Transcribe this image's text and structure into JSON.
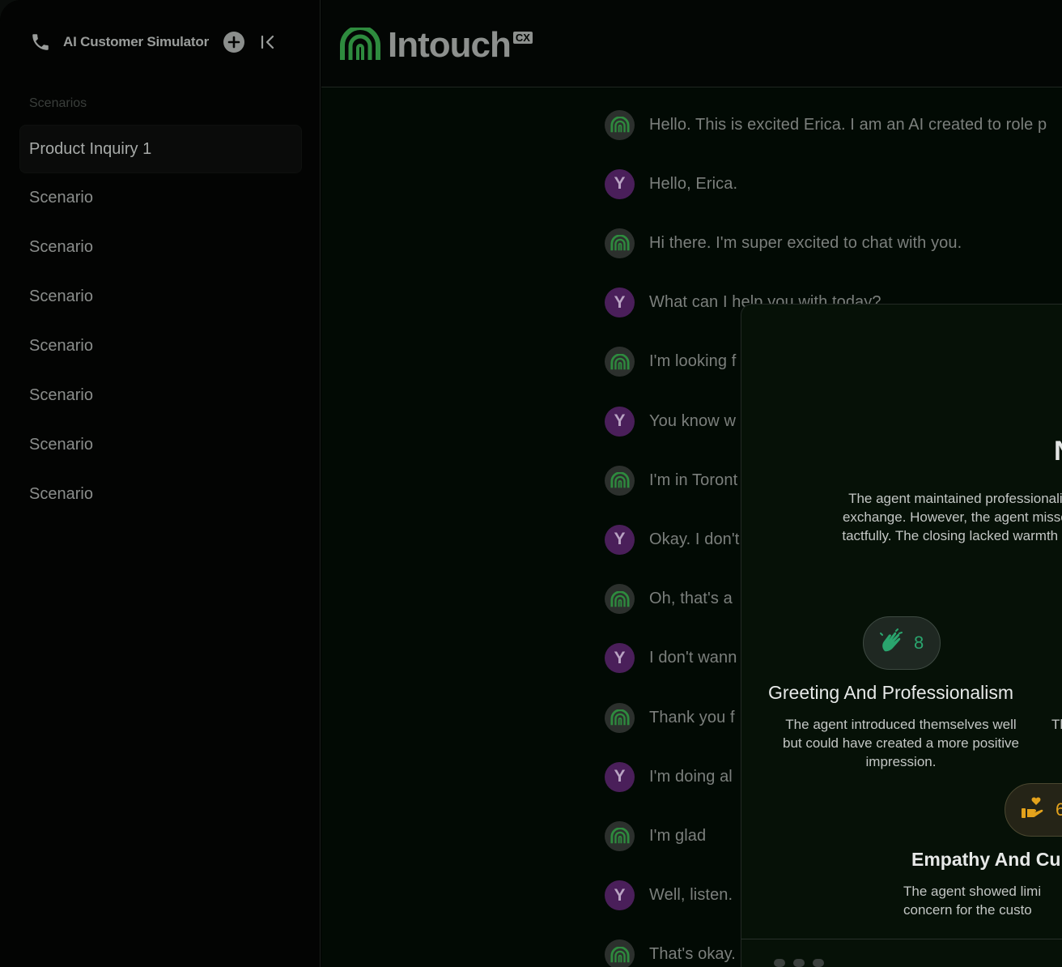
{
  "sidebar": {
    "title": "AI Customer Simulator",
    "section_label": "Scenarios",
    "items": [
      {
        "label": "Product Inquiry 1"
      },
      {
        "label": "Scenario"
      },
      {
        "label": "Scenario"
      },
      {
        "label": "Scenario"
      },
      {
        "label": "Scenario"
      },
      {
        "label": "Scenario"
      },
      {
        "label": "Scenario"
      },
      {
        "label": "Scenario"
      }
    ]
  },
  "header": {
    "logo_text": "Intouch",
    "logo_badge": "CX",
    "brand_color": "#2e8b3e"
  },
  "chat": {
    "user_initial": "Y",
    "messages": [
      {
        "role": "ai",
        "text": "Hello. This is excited Erica. I am an AI created to role p"
      },
      {
        "role": "user",
        "text": "Hello, Erica."
      },
      {
        "role": "ai",
        "text": "Hi there. I'm super excited to chat with you."
      },
      {
        "role": "user",
        "text": "What can I help you with today?"
      },
      {
        "role": "ai",
        "text": "I'm looking f"
      },
      {
        "role": "user",
        "text": "You know w"
      },
      {
        "role": "ai",
        "text": "I'm in Toront"
      },
      {
        "role": "user",
        "text": "Okay. I don't"
      },
      {
        "role": "ai",
        "text": "Oh, that's a"
      },
      {
        "role": "user",
        "text": "I don't wann"
      },
      {
        "role": "ai",
        "text": "Thank you f"
      },
      {
        "role": "user",
        "text": "I'm doing al"
      },
      {
        "role": "ai",
        "text": "I'm glad"
      },
      {
        "role": "user",
        "text": "Well, listen."
      },
      {
        "role": "ai",
        "text": "That's okay."
      }
    ]
  },
  "evaluation": {
    "heading": "N",
    "summary_lines": [
      "The agent maintained professionalism thr",
      "exchange. However, the agent missed an o",
      "tactfully. The closing lacked warmth and did"
    ],
    "categories": [
      {
        "icon": "clapping-hands-icon",
        "score": "8",
        "title": "Greeting And Professionalism",
        "description_lines": [
          "The agent introduced themselves well",
          "but could have created a more positive",
          "impression."
        ],
        "side_fragment": "Th"
      },
      {
        "icon": "hand-heart-icon",
        "score": "6",
        "title": "Empathy And Cu",
        "description_lines": [
          "The agent showed limi",
          "concern for the custo"
        ]
      }
    ]
  }
}
